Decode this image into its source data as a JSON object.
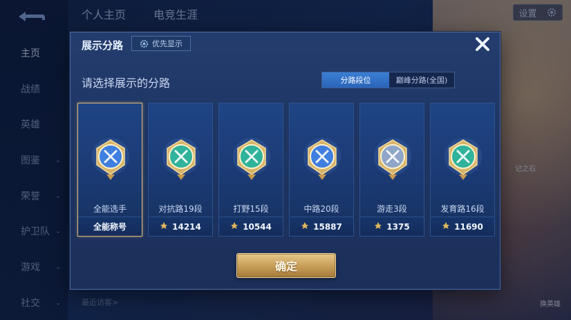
{
  "background": {
    "nav_tabs": [
      "个人主页",
      "电竞生涯"
    ],
    "settings_label": "设置",
    "sidebar": [
      {
        "label": "主页",
        "active": true,
        "chevron": false
      },
      {
        "label": "战绩",
        "active": false,
        "chevron": false
      },
      {
        "label": "英雄",
        "active": false,
        "chevron": false
      },
      {
        "label": "图鉴",
        "active": false,
        "chevron": true
      },
      {
        "label": "荣誉",
        "active": false,
        "chevron": true
      },
      {
        "label": "护卫队",
        "active": false,
        "chevron": true
      },
      {
        "label": "游戏",
        "active": false,
        "chevron": true
      },
      {
        "label": "社交",
        "active": false,
        "chevron": true
      }
    ],
    "recent_visitors_label": "最近访客>",
    "right_labels": [
      "记之石",
      "换英雄"
    ]
  },
  "modal": {
    "title": "展示分路",
    "priority_button": "优先显示",
    "prompt": "请选择展示的分路",
    "segment": {
      "options": [
        "分路段位",
        "巅峰分路(全国)"
      ],
      "active_index": 0
    },
    "cards": [
      {
        "rank": "全能选手",
        "bottom": "全能称号",
        "points": null,
        "selected": true,
        "emblem": "all-round-emblem-icon",
        "color": "#3f7fe0"
      },
      {
        "rank": "对抗路19段",
        "bottom": "14214",
        "points": true,
        "selected": false,
        "emblem": "clash-lane-emblem-icon",
        "color": "#2fb39a"
      },
      {
        "rank": "打野15段",
        "bottom": "10544",
        "points": true,
        "selected": false,
        "emblem": "jungle-emblem-icon",
        "color": "#2fb39a"
      },
      {
        "rank": "中路20段",
        "bottom": "15887",
        "points": true,
        "selected": false,
        "emblem": "mid-lane-emblem-icon",
        "color": "#3f7fe0"
      },
      {
        "rank": "游走3段",
        "bottom": "1375",
        "points": true,
        "selected": false,
        "emblem": "roam-emblem-icon",
        "color": "#8fa6c8"
      },
      {
        "rank": "发育路16段",
        "bottom": "11690",
        "points": true,
        "selected": false,
        "emblem": "farm-lane-emblem-icon",
        "color": "#2fb39a"
      }
    ],
    "confirm_label": "确定"
  }
}
